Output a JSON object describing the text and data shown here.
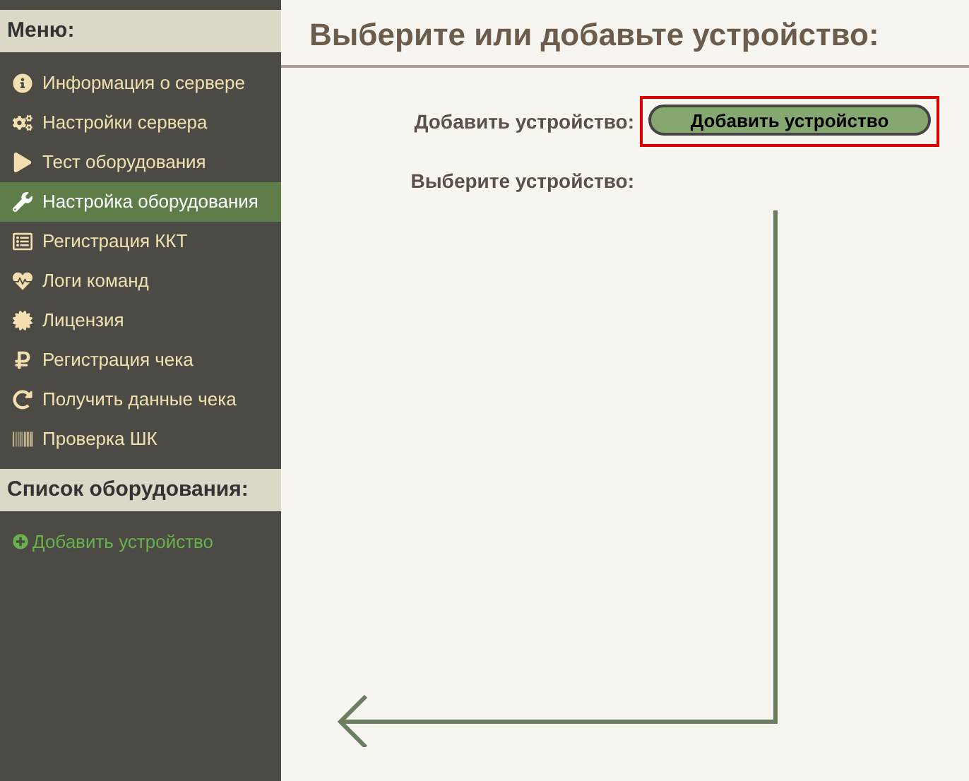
{
  "sidebar": {
    "menu_title": "Меню:",
    "items": [
      {
        "kind": "info",
        "label": "Информация о сервере",
        "selected": false
      },
      {
        "kind": "gears",
        "label": "Настройки сервера",
        "selected": false
      },
      {
        "kind": "play",
        "label": "Тест оборудования",
        "selected": false
      },
      {
        "kind": "wrench",
        "label": "Настройка оборудования",
        "selected": true
      },
      {
        "kind": "form",
        "label": "Регистрация ККТ",
        "selected": false
      },
      {
        "kind": "heartbeat",
        "label": "Логи команд",
        "selected": false
      },
      {
        "kind": "certificate",
        "label": "Лицензия",
        "selected": false
      },
      {
        "kind": "ruble",
        "label": "Регистрация чека",
        "selected": false
      },
      {
        "kind": "refresh",
        "label": "Получить данные чека",
        "selected": false
      },
      {
        "kind": "barcode",
        "label": "Проверка ШК",
        "selected": false
      }
    ],
    "equipment_title": "Список оборудования:",
    "add_link": "Добавить устройство"
  },
  "main": {
    "title": "Выберите или добавьте устройство:",
    "add_label": "Добавить устройство:",
    "add_button": {
      "label": "Добавить устройство",
      "highlighted": true
    },
    "select_label": "Выберите устройство:"
  }
}
